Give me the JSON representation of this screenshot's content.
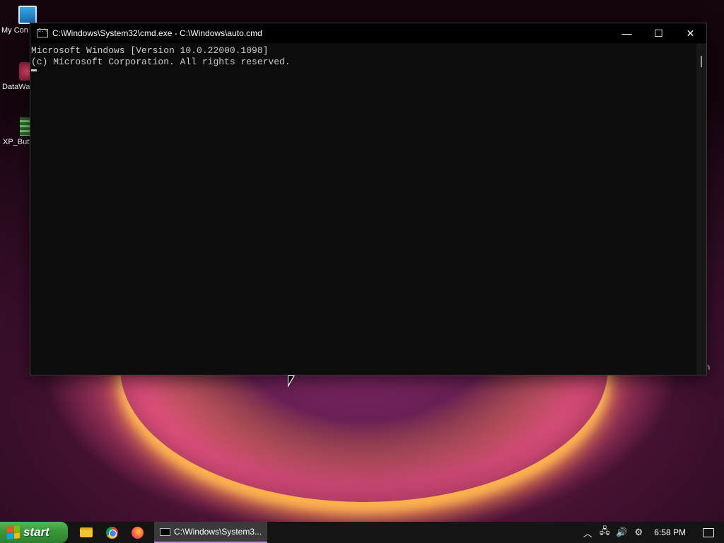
{
  "desktop": {
    "icons": [
      {
        "label": "My Con"
      },
      {
        "label": "DataWa"
      },
      {
        "label": "XP_Butt"
      }
    ],
    "edge_fragment": "n"
  },
  "cmd_window": {
    "title": "C:\\Windows\\System32\\cmd.exe - C:\\Windows\\auto.cmd",
    "minimize_glyph": "—",
    "maximize_glyph": "☐",
    "close_glyph": "✕",
    "console_lines": [
      "Microsoft Windows [Version 10.0.22000.1098]",
      "(c) Microsoft Corporation. All rights reserved."
    ]
  },
  "taskbar": {
    "start_label": "start",
    "pinned": [
      {
        "name": "file-explorer-icon"
      },
      {
        "name": "chrome-icon"
      },
      {
        "name": "firefox-icon"
      }
    ],
    "active_task_label": "C:\\Windows\\System3...",
    "tray": {
      "chevron": "︿",
      "network": "🖧",
      "volume": "🔊",
      "settings": "⚙",
      "time": "6:58 PM"
    }
  },
  "colors": {
    "console_bg": "#0c0c0c",
    "console_text": "#cccccc",
    "start_green": "#3a983a",
    "active_task_accent": "#c58ad8"
  }
}
